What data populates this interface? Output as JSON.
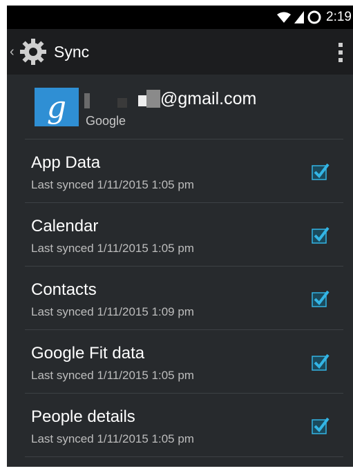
{
  "status_bar": {
    "time": "2:19",
    "wifi_icon": "wifi-icon",
    "signal_icon": "signal-icon",
    "sync_icon": "sync-ring-icon"
  },
  "action_bar": {
    "title": "Sync",
    "app_icon": "settings-gear-icon",
    "overflow_icon": "overflow-menu-icon"
  },
  "account": {
    "email": "@gmail.com",
    "type": "Google",
    "logo_letter": "g"
  },
  "items": [
    {
      "title": "App Data",
      "subtitle": "Last synced 1/11/2015 1:05 pm",
      "checked": true
    },
    {
      "title": "Calendar",
      "subtitle": "Last synced 1/11/2015 1:05 pm",
      "checked": true
    },
    {
      "title": "Contacts",
      "subtitle": "Last synced 1/11/2015 1:09 pm",
      "checked": true
    },
    {
      "title": "Google Fit data",
      "subtitle": "Last synced 1/11/2015 1:05 pm",
      "checked": true
    },
    {
      "title": "People details",
      "subtitle": "Last synced 1/11/2015 1:05 pm",
      "checked": true
    }
  ],
  "colors": {
    "accent": "#33b5e5",
    "background": "#272a2d",
    "action_bar": "#1c1d1f",
    "google_blue": "#2f8fd4"
  }
}
